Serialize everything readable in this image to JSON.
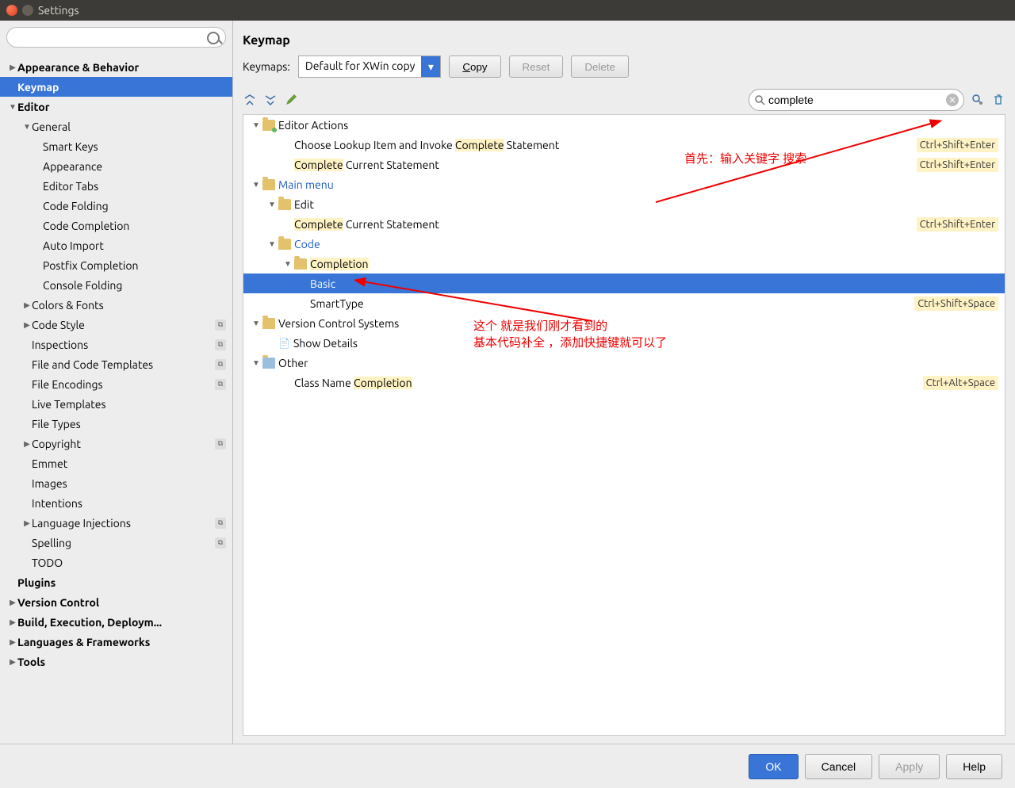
{
  "window": {
    "title": "Settings"
  },
  "sidebar": {
    "search_placeholder": "",
    "items": [
      {
        "label": "Appearance & Behavior",
        "depth": 0,
        "bold": true,
        "arrow": "▶",
        "tag": false
      },
      {
        "label": "Keymap",
        "depth": 0,
        "bold": true,
        "selected": true,
        "tag": false
      },
      {
        "label": "Editor",
        "depth": 0,
        "bold": true,
        "arrow": "▼",
        "tag": false
      },
      {
        "label": "General",
        "depth": 1,
        "arrow": "▼",
        "tag": false
      },
      {
        "label": "Smart Keys",
        "depth": 2,
        "tag": false
      },
      {
        "label": "Appearance",
        "depth": 2,
        "tag": false
      },
      {
        "label": "Editor Tabs",
        "depth": 2,
        "tag": false
      },
      {
        "label": "Code Folding",
        "depth": 2,
        "tag": false
      },
      {
        "label": "Code Completion",
        "depth": 2,
        "tag": false
      },
      {
        "label": "Auto Import",
        "depth": 2,
        "tag": false
      },
      {
        "label": "Postfix Completion",
        "depth": 2,
        "tag": false
      },
      {
        "label": "Console Folding",
        "depth": 2,
        "tag": false
      },
      {
        "label": "Colors & Fonts",
        "depth": 1,
        "arrow": "▶",
        "tag": false
      },
      {
        "label": "Code Style",
        "depth": 1,
        "arrow": "▶",
        "tag": true
      },
      {
        "label": "Inspections",
        "depth": 1,
        "tag": true
      },
      {
        "label": "File and Code Templates",
        "depth": 1,
        "tag": true
      },
      {
        "label": "File Encodings",
        "depth": 1,
        "tag": true
      },
      {
        "label": "Live Templates",
        "depth": 1,
        "tag": false
      },
      {
        "label": "File Types",
        "depth": 1,
        "tag": false
      },
      {
        "label": "Copyright",
        "depth": 1,
        "arrow": "▶",
        "tag": true
      },
      {
        "label": "Emmet",
        "depth": 1,
        "tag": false
      },
      {
        "label": "Images",
        "depth": 1,
        "tag": false
      },
      {
        "label": "Intentions",
        "depth": 1,
        "tag": false
      },
      {
        "label": "Language Injections",
        "depth": 1,
        "arrow": "▶",
        "tag": true
      },
      {
        "label": "Spelling",
        "depth": 1,
        "tag": true
      },
      {
        "label": "TODO",
        "depth": 1,
        "tag": false
      },
      {
        "label": "Plugins",
        "depth": 0,
        "bold": true,
        "tag": false
      },
      {
        "label": "Version Control",
        "depth": 0,
        "bold": true,
        "arrow": "▶",
        "tag": false
      },
      {
        "label": "Build, Execution, Deploym...",
        "depth": 0,
        "bold": true,
        "arrow": "▶",
        "tag": false
      },
      {
        "label": "Languages & Frameworks",
        "depth": 0,
        "bold": true,
        "arrow": "▶",
        "tag": false
      },
      {
        "label": "Tools",
        "depth": 0,
        "bold": true,
        "arrow": "▶",
        "tag": false
      }
    ]
  },
  "panel": {
    "title": "Keymap",
    "keymaps_label": "Keymaps:",
    "dropdown_value": "Default for XWin copy",
    "copy_btn": "Copy",
    "reset_btn": "Reset",
    "delete_btn": "Delete",
    "search_value": "complete"
  },
  "rows": [
    {
      "depth": 0,
      "arrow": "▼",
      "icon": "folder-green",
      "pre": "",
      "hl": "",
      "post": "Editor Actions",
      "shortcut": ""
    },
    {
      "depth": 2,
      "arrow": "",
      "icon": "",
      "pre": "Choose Lookup Item and Invoke ",
      "hl": "Complete",
      "post": " Statement",
      "shortcut": "Ctrl+Shift+Enter"
    },
    {
      "depth": 2,
      "arrow": "",
      "icon": "",
      "pre": "",
      "hl": "Complete",
      "post": " Current Statement",
      "shortcut": "Ctrl+Shift+Enter"
    },
    {
      "depth": 0,
      "arrow": "▼",
      "icon": "folder",
      "pre": "",
      "hl": "",
      "post": "Main menu",
      "link": true,
      "shortcut": ""
    },
    {
      "depth": 1,
      "arrow": "▼",
      "icon": "folder",
      "pre": "",
      "hl": "",
      "post": "Edit",
      "shortcut": ""
    },
    {
      "depth": 2,
      "arrow": "",
      "icon": "",
      "pre": "",
      "hl": "Complete",
      "post": " Current Statement",
      "shortcut": "Ctrl+Shift+Enter"
    },
    {
      "depth": 1,
      "arrow": "▼",
      "icon": "folder",
      "pre": "",
      "hl": "",
      "post": "Code",
      "link": true,
      "shortcut": ""
    },
    {
      "depth": 2,
      "arrow": "▼",
      "icon": "folder",
      "pre": "",
      "hl": "Completion",
      "post": "",
      "shortcut": ""
    },
    {
      "depth": 3,
      "arrow": "",
      "icon": "",
      "pre": "",
      "hl": "",
      "post": "Basic",
      "selected": true,
      "shortcut": ""
    },
    {
      "depth": 3,
      "arrow": "",
      "icon": "",
      "pre": "",
      "hl": "",
      "post": "SmartType",
      "shortcut": "Ctrl+Shift+Space"
    },
    {
      "depth": 0,
      "arrow": "▼",
      "icon": "folder",
      "pre": "",
      "hl": "",
      "post": "Version Control Systems",
      "shortcut": ""
    },
    {
      "depth": 1,
      "arrow": "",
      "icon": "details",
      "pre": "",
      "hl": "",
      "post": "Show Details",
      "shortcut": ""
    },
    {
      "depth": 0,
      "arrow": "▼",
      "icon": "folder-other",
      "pre": "",
      "hl": "",
      "post": "Other",
      "shortcut": ""
    },
    {
      "depth": 2,
      "arrow": "",
      "icon": "",
      "pre": "Class Name ",
      "hl": "Completion",
      "post": "",
      "shortcut": "Ctrl+Alt+Space"
    }
  ],
  "annotations": {
    "a1": "首先：输入关键字 搜索",
    "a2_line1": "这个 就是我们刚才看到的",
    "a2_line2": "基本代码补全 ，添加快捷键就可以了"
  },
  "footer": {
    "ok": "OK",
    "cancel": "Cancel",
    "apply": "Apply",
    "help": "Help"
  }
}
